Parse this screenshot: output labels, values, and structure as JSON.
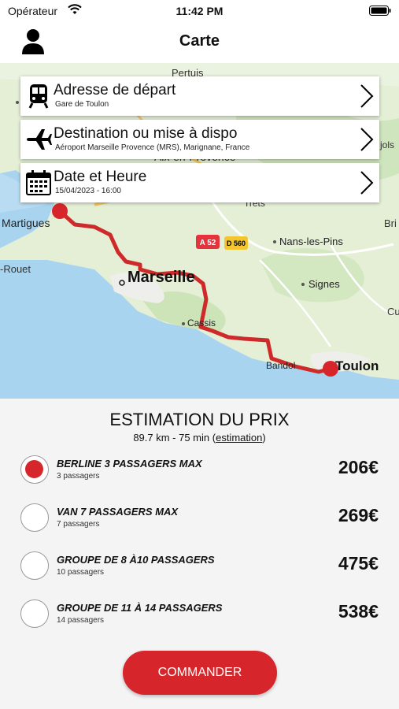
{
  "status": {
    "carrier": "Opérateur",
    "time": "11:42 PM"
  },
  "nav": {
    "title": "Carte",
    "profile_icon": "person-icon"
  },
  "map": {
    "labels": {
      "pertuis": "Pertuis",
      "martigues": "Martigues",
      "marseille": "Marseille",
      "rouet": "-Rouet",
      "aix": "Aix-en-Provence",
      "trets": "Trets",
      "nans": "Nans-les-Pins",
      "signes": "Signes",
      "cassis": "Cassis",
      "bandol": "Bandol",
      "toulon": "Toulon",
      "jols": "jols",
      "bri": "Bri",
      "cu": "Cu"
    },
    "road_badges": {
      "a52": "A 52",
      "d560": "D 560"
    },
    "route_color": "#cf2a2a"
  },
  "cards": {
    "departure": {
      "title": "Adresse de départ",
      "subtitle": "Gare de Toulon",
      "icon": "train-icon"
    },
    "destination": {
      "title": "Destination ou mise à dispo",
      "subtitle": "Aéroport Marseille Provence (MRS), Marignane, France",
      "icon": "airplane-icon"
    },
    "datetime": {
      "title": "Date et Heure",
      "subtitle": "15/04/2023 - 16:00",
      "icon": "calendar-icon"
    }
  },
  "estimate": {
    "title": "ESTIMATION DU PRIX",
    "summary": "89.7 km - 75 min",
    "link": "estimation"
  },
  "options": [
    {
      "name": "BERLINE 3 PASSAGERS MAX",
      "passengers": "3 passagers",
      "price": "206€",
      "selected": true
    },
    {
      "name": "VAN 7 PASSAGERS MAX",
      "passengers": "7 passagers",
      "price": "269€",
      "selected": false
    },
    {
      "name": "GROUPE DE 8 À10 PASSAGERS",
      "passengers": "10 passagers",
      "price": "475€",
      "selected": false
    },
    {
      "name": "GROUPE DE 11 À 14 PASSAGERS",
      "passengers": "14 passagers",
      "price": "538€",
      "selected": false
    }
  ],
  "order_button": {
    "label": "COMMANDER"
  },
  "colors": {
    "accent": "#d6262b",
    "sea": "#a9d4ef",
    "land": "#e2efd3"
  }
}
